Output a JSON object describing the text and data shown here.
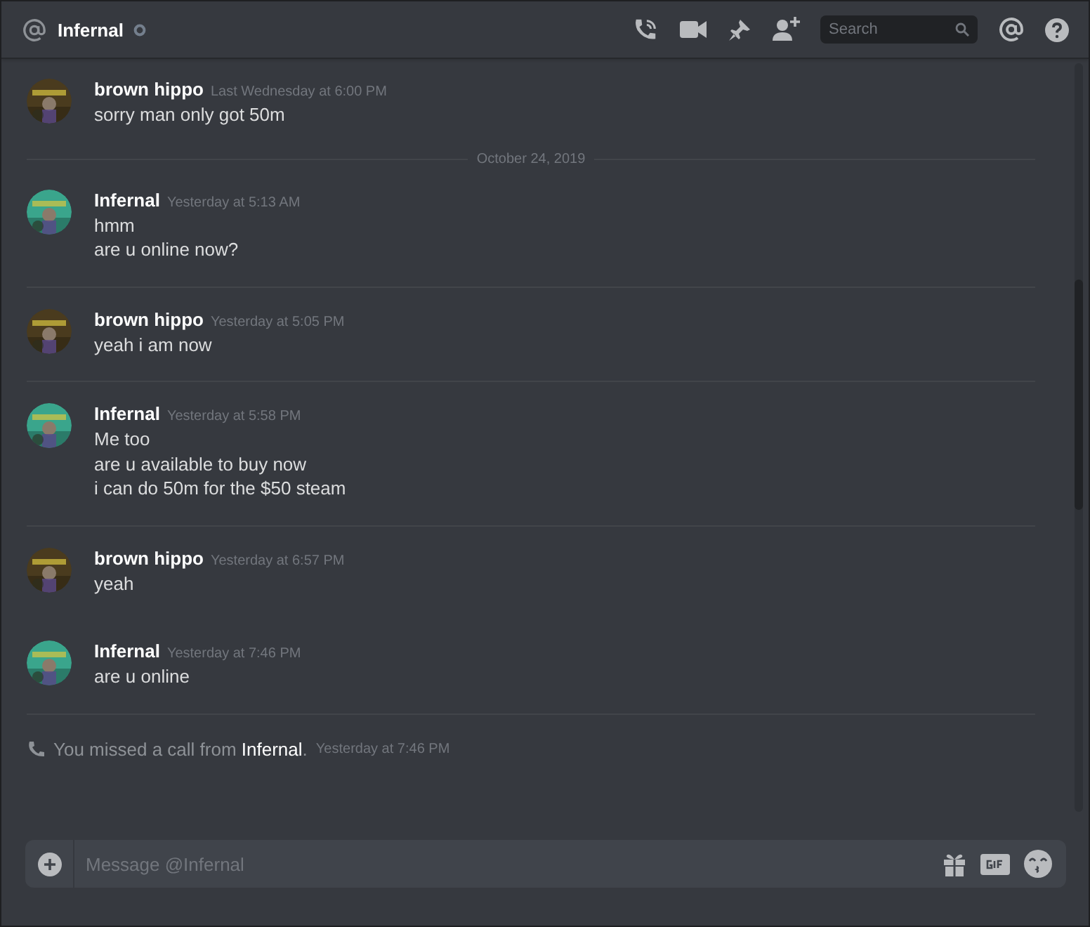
{
  "header": {
    "channel": "Infernal",
    "search": {
      "placeholder": "Search"
    }
  },
  "messages": [
    {
      "kind": "message",
      "author": "brown hippo",
      "timestamp": "Last Wednesday at 6:00 PM",
      "avatar": {
        "kind": "picture",
        "color": "#4a3b1e"
      },
      "lines": [
        "sorry man only got 50m"
      ]
    },
    {
      "kind": "date",
      "label": "October 24, 2019"
    },
    {
      "kind": "message",
      "author": "Infernal",
      "timestamp": "Yesterday at 5:13 AM",
      "avatar": {
        "kind": "picture",
        "color": "#3aa58c"
      },
      "lines": [
        "hmm",
        "are u online now?"
      ]
    },
    {
      "kind": "separator"
    },
    {
      "kind": "message",
      "author": "brown hippo",
      "timestamp": "Yesterday at 5:05 PM",
      "avatar": {
        "kind": "picture",
        "color": "#4a3b1e"
      },
      "lines": [
        "yeah i am now"
      ]
    },
    {
      "kind": "separator"
    },
    {
      "kind": "message",
      "author": "Infernal",
      "timestamp": "Yesterday at 5:58 PM",
      "avatar": {
        "kind": "picture",
        "color": "#3aa58c"
      },
      "lines": [
        "Me too",
        "are u available to buy now",
        "i can do 50m for the $50 steam"
      ]
    },
    {
      "kind": "separator"
    },
    {
      "kind": "message",
      "author": "brown hippo",
      "timestamp": "Yesterday at 6:57 PM",
      "avatar": {
        "kind": "picture",
        "color": "#4a3b1e"
      },
      "lines": [
        "yeah"
      ]
    },
    {
      "kind": "message",
      "author": "Infernal",
      "timestamp": "Yesterday at 7:46 PM",
      "avatar": {
        "kind": "picture",
        "color": "#3aa58c"
      },
      "lines": [
        "are u online"
      ]
    },
    {
      "kind": "separator"
    },
    {
      "kind": "call",
      "text": "You missed a call from **Infernal**.",
      "timestamp": "Yesterday at 7:46 PM"
    }
  ],
  "composer": {
    "placeholder": "Message @Infernal"
  }
}
